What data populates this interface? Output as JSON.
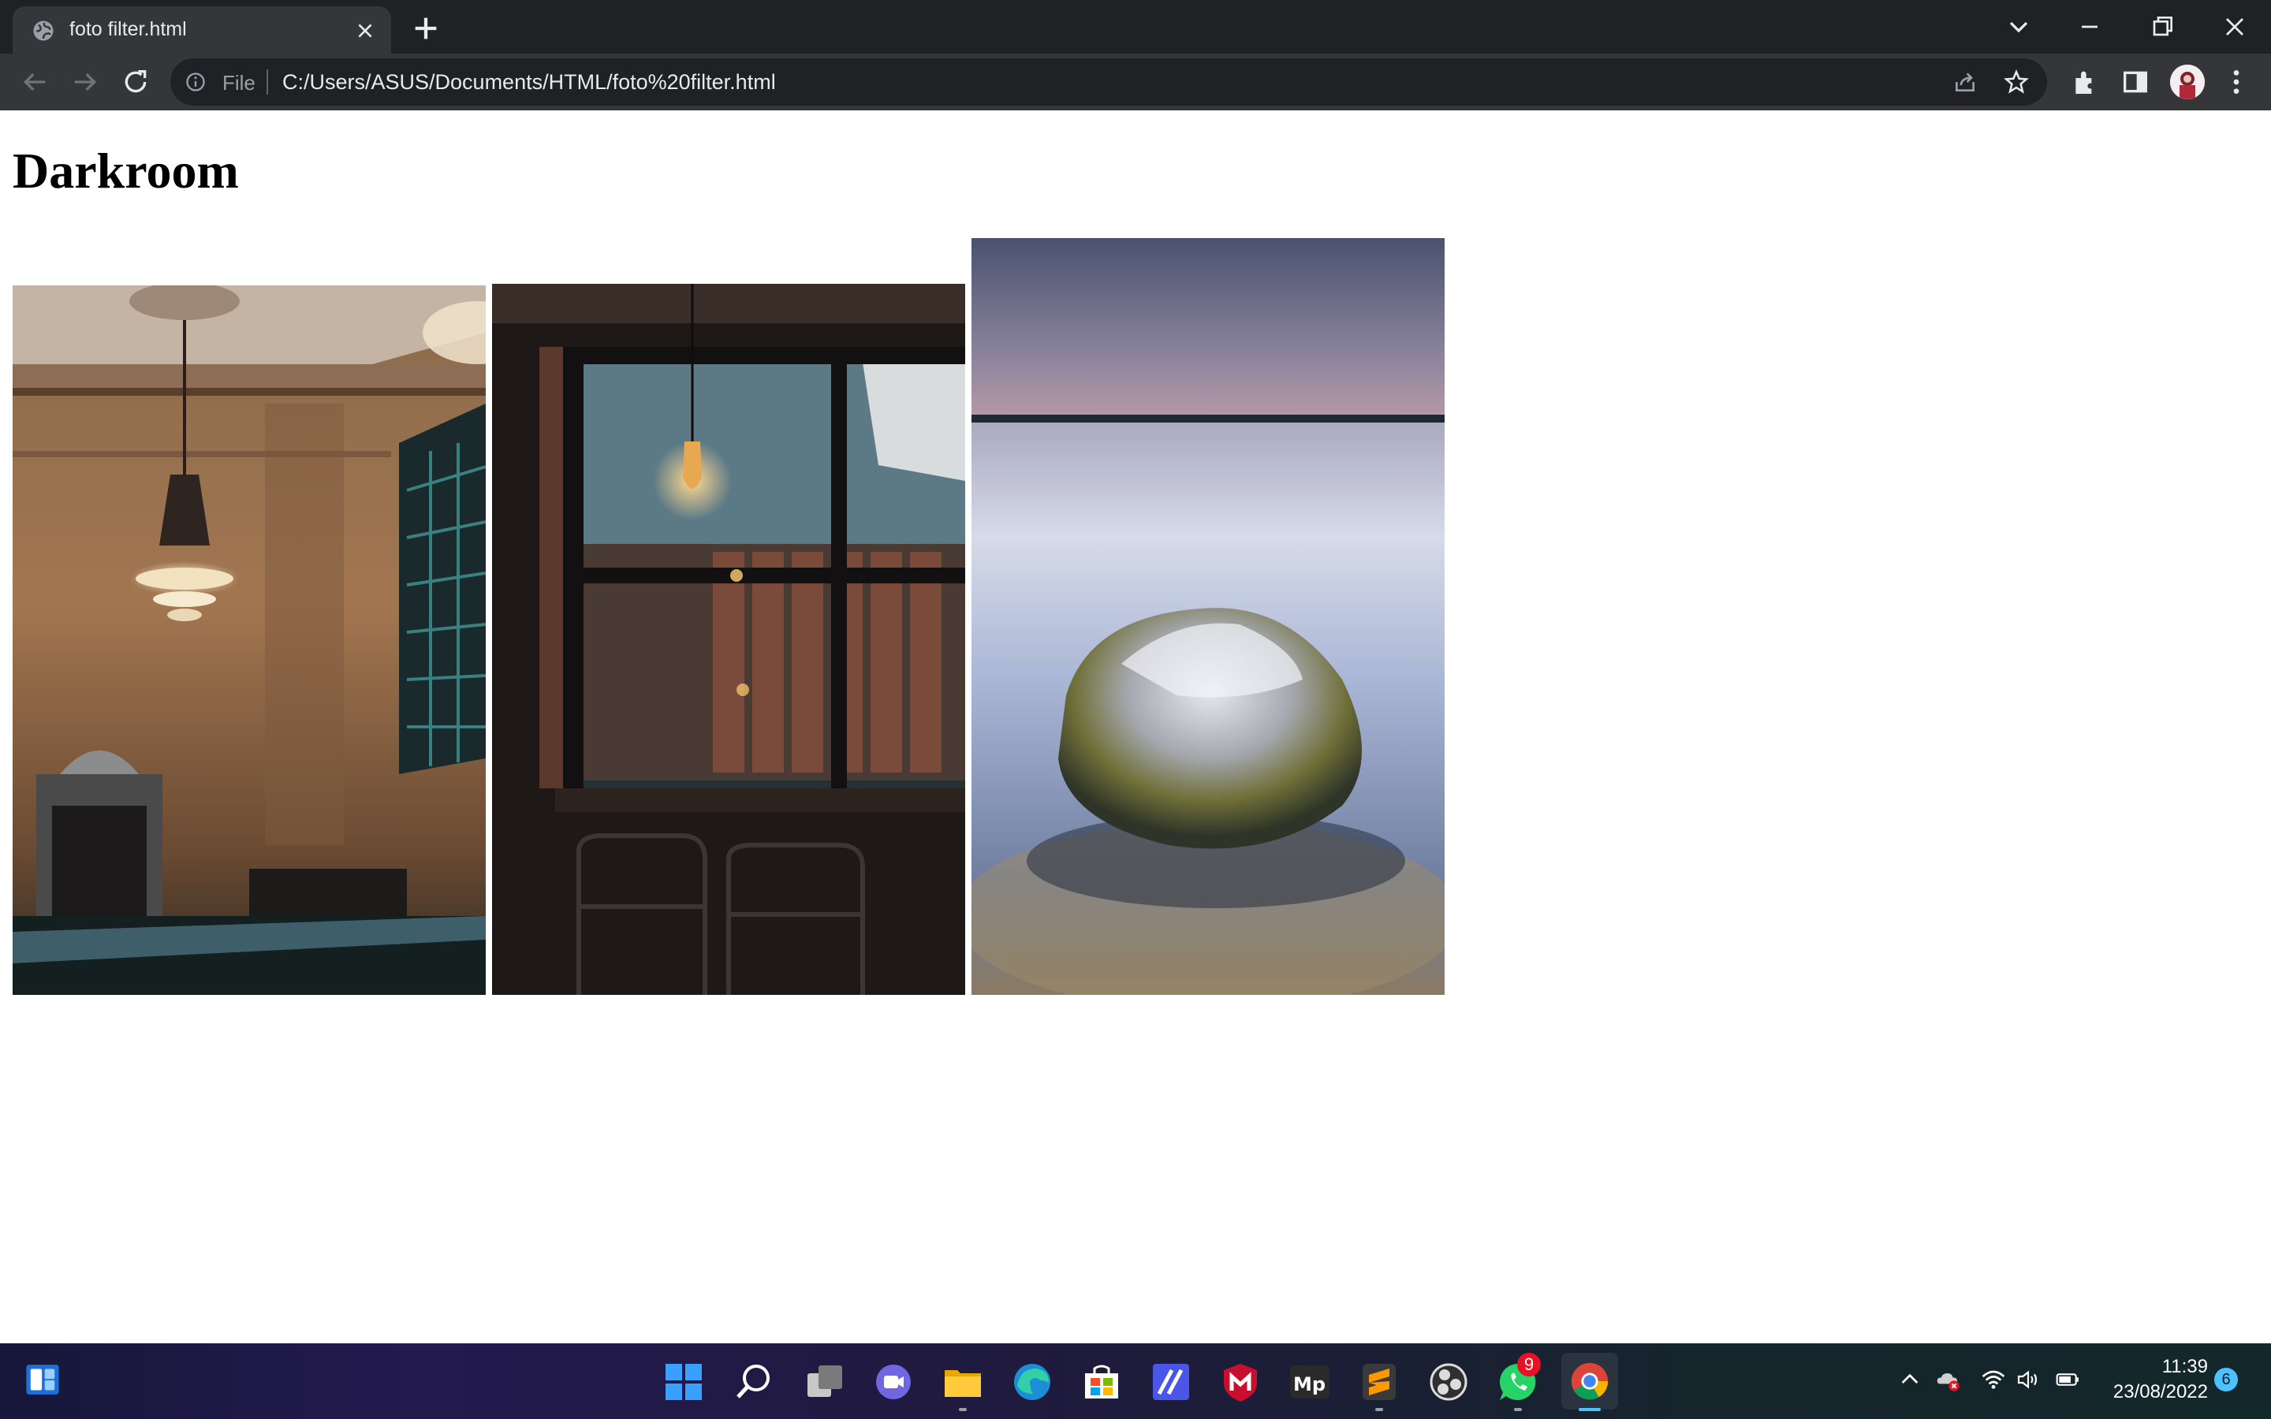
{
  "browser": {
    "tab_title": "foto filter.html",
    "scheme_label": "File",
    "url": "C:/Users/ASUS/Documents/HTML/foto%20filter.html"
  },
  "page": {
    "heading": "Darkroom",
    "photos": [
      {
        "subject": "grand hall interior with chandelier"
      },
      {
        "subject": "window with hanging bulb and two chairs"
      },
      {
        "subject": "mossy rock in misty lake at dusk"
      }
    ]
  },
  "taskbar": {
    "apps": [
      "start-icon",
      "search-icon",
      "task-view-icon",
      "chat-icon",
      "file-explorer-icon",
      "edge-icon",
      "store-icon",
      "editor-icon",
      "mcafee-icon",
      "media-player-icon",
      "sublime-text-icon",
      "obs-icon",
      "whatsapp-icon",
      "chrome-icon"
    ],
    "whatsapp_badge": "9",
    "time": "11:39",
    "date": "23/08/2022",
    "notification_count": "6"
  },
  "colors": {
    "tab_strip": "#202124",
    "toolbar": "#35363a",
    "accent": "#4cc2ff"
  }
}
